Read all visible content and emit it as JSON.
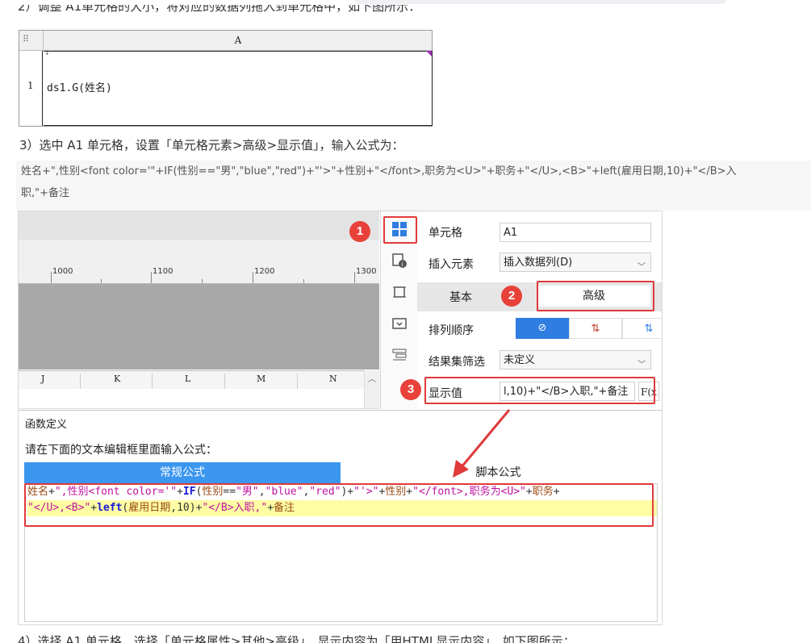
{
  "page": {
    "step2_text": "2）调整 A1单元格的大小，将对应的数据列拖入到单元格中，如下图所示：",
    "step3_text": "3）选中 A1 单元格，设置「单元格元素>高级>显示值」，输入公式为：",
    "formula_line1": "姓名+\",性别<font color='\"+IF(性别==\"男\",\"blue\",\"red\")+\"'>\"+性别+\"</font>,职务为<U>\"+职务+\"</U>,<B>\"+left(雇用日期,10)+\"</B>入",
    "formula_line2": "职,\"+备注",
    "step4_text": "4）选择 A1 单元格，选择「单元格属性>其他>高级」，显示内容为「用HTML显示内容」，如下图所示："
  },
  "sheet1": {
    "column": "A",
    "row": "1",
    "cell_value": "ds1.G(姓名)"
  },
  "designer": {
    "ruler": [
      "1000",
      "1100",
      "1200",
      "1300"
    ],
    "columns": [
      "J",
      "K",
      "L",
      "M",
      "N"
    ],
    "props": {
      "cell_label": "单元格",
      "cell_value": "A1",
      "insert_label": "插入元素",
      "insert_value": "插入数据列(D)",
      "tab_basic": "基本",
      "tab_advanced": "高级",
      "sort_label": "排列顺序",
      "sort_none": "⊘",
      "sort_asc": "⇅",
      "sort_desc": "⇅",
      "filter_label": "结果集筛选",
      "filter_value": "未定义",
      "display_label": "显示值",
      "display_value": "l,10)+\"</B>入职,\"+备注",
      "fx_label": "F(x"
    },
    "badges": [
      "1",
      "2",
      "3"
    ]
  },
  "dialog": {
    "title": "函数定义",
    "prompt": "请在下面的文本编辑框里面输入公式：",
    "tab_normal": "常规公式",
    "tab_script": "脚本公式"
  },
  "colors": {
    "annotation_red": "#e03a3a",
    "tab_blue": "#3b96f0",
    "highlight_yellow": "#fefda4",
    "sort_active": "#2f7de1"
  }
}
